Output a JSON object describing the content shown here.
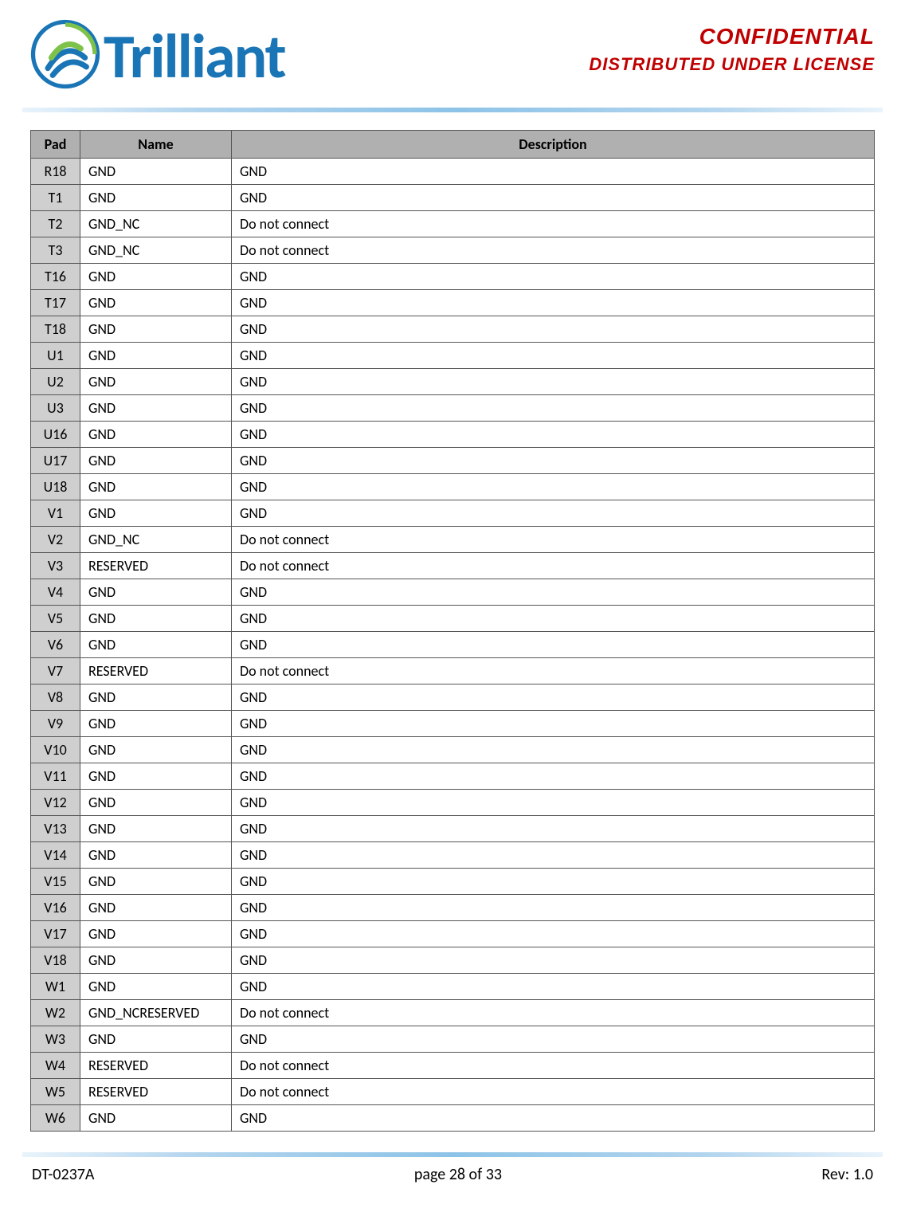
{
  "header": {
    "logo_text": "Trilliant",
    "confidential": "CONFIDENTIAL",
    "distributed": "DISTRIBUTED UNDER LICENSE"
  },
  "table": {
    "headers": {
      "pad": "Pad",
      "name": "Name",
      "description": "Description"
    },
    "rows": [
      {
        "pad": "R18",
        "name": "GND",
        "desc": "GND"
      },
      {
        "pad": "T1",
        "name": "GND",
        "desc": "GND"
      },
      {
        "pad": "T2",
        "name": "GND_NC",
        "desc": "Do not connect"
      },
      {
        "pad": "T3",
        "name": "GND_NC",
        "desc": "Do not connect"
      },
      {
        "pad": "T16",
        "name": "GND",
        "desc": "GND"
      },
      {
        "pad": "T17",
        "name": "GND",
        "desc": "GND"
      },
      {
        "pad": "T18",
        "name": "GND",
        "desc": "GND"
      },
      {
        "pad": "U1",
        "name": "GND",
        "desc": "GND"
      },
      {
        "pad": "U2",
        "name": "GND",
        "desc": "GND"
      },
      {
        "pad": "U3",
        "name": "GND",
        "desc": "GND"
      },
      {
        "pad": "U16",
        "name": "GND",
        "desc": "GND"
      },
      {
        "pad": "U17",
        "name": "GND",
        "desc": "GND"
      },
      {
        "pad": "U18",
        "name": "GND",
        "desc": "GND"
      },
      {
        "pad": "V1",
        "name": "GND",
        "desc": "GND"
      },
      {
        "pad": "V2",
        "name": "GND_NC",
        "desc": "Do not connect"
      },
      {
        "pad": "V3",
        "name": "RESERVED",
        "desc": "Do not connect"
      },
      {
        "pad": "V4",
        "name": "GND",
        "desc": "GND"
      },
      {
        "pad": "V5",
        "name": "GND",
        "desc": "GND"
      },
      {
        "pad": "V6",
        "name": "GND",
        "desc": "GND"
      },
      {
        "pad": "V7",
        "name": "RESERVED",
        "desc": "Do not connect"
      },
      {
        "pad": "V8",
        "name": "GND",
        "desc": "GND"
      },
      {
        "pad": "V9",
        "name": "GND",
        "desc": "GND"
      },
      {
        "pad": "V10",
        "name": "GND",
        "desc": "GND"
      },
      {
        "pad": "V11",
        "name": "GND",
        "desc": "GND"
      },
      {
        "pad": "V12",
        "name": "GND",
        "desc": "GND"
      },
      {
        "pad": "V13",
        "name": "GND",
        "desc": "GND"
      },
      {
        "pad": "V14",
        "name": "GND",
        "desc": "GND"
      },
      {
        "pad": "V15",
        "name": "GND",
        "desc": "GND"
      },
      {
        "pad": "V16",
        "name": "GND",
        "desc": "GND"
      },
      {
        "pad": "V17",
        "name": "GND",
        "desc": "GND"
      },
      {
        "pad": "V18",
        "name": "GND",
        "desc": "GND"
      },
      {
        "pad": "W1",
        "name": "GND",
        "desc": "GND"
      },
      {
        "pad": "W2",
        "name": "GND_NCRESERVED",
        "desc": "Do not connect"
      },
      {
        "pad": "W3",
        "name": "GND",
        "desc": "GND"
      },
      {
        "pad": "W4",
        "name": "RESERVED",
        "desc": "Do not connect"
      },
      {
        "pad": "W5",
        "name": "RESERVED",
        "desc": "Do not connect"
      },
      {
        "pad": "W6",
        "name": "GND",
        "desc": "GND"
      }
    ]
  },
  "footer": {
    "doc_id": "DT-0237A",
    "page": "page 28 of 33",
    "rev": "Rev: 1.0"
  }
}
